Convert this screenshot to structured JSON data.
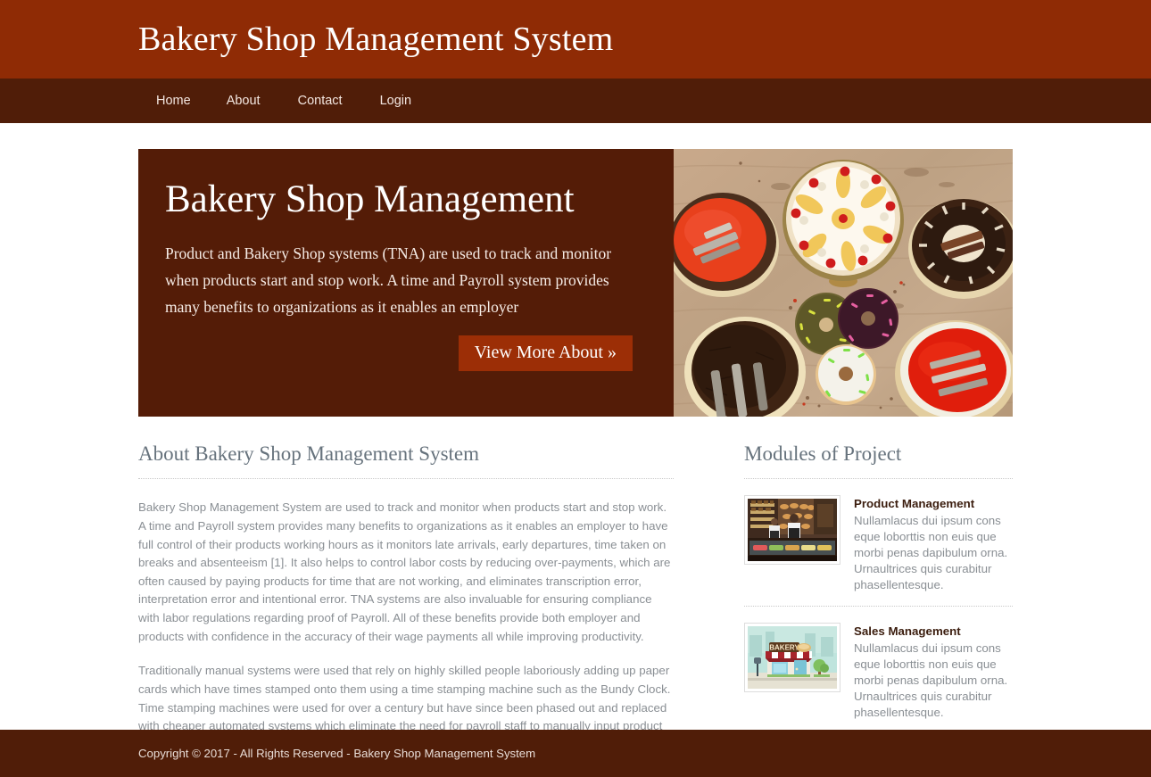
{
  "header": {
    "title": "Bakery Shop Management System",
    "bg_color": "#8f2b05"
  },
  "nav": {
    "bg_color": "#501d08",
    "items": [
      {
        "label": "Home"
      },
      {
        "label": "About"
      },
      {
        "label": "Contact"
      },
      {
        "label": "Login"
      }
    ]
  },
  "hero": {
    "bg_color": "#541c07",
    "title": "Bakery Shop Management",
    "description": "Product and Bakery Shop systems (TNA) are used to track and monitor when products start and stop work. A time and Payroll system provides many benefits to organizations as it enables an employer",
    "button_label": "View More About »",
    "button_color": "#9c2e06",
    "image_name": "assorted-cakes-and-donuts-photo"
  },
  "about": {
    "heading": "About Bakery Shop Management System",
    "paragraphs": [
      "Bakery Shop Management System are used to track and monitor when products start and stop work. A time and Payroll system provides many benefits to organizations as it enables an employer to have full control of their products working hours as it monitors late arrivals, early departures, time taken on breaks and absenteeism [1]. It also helps to control labor costs by reducing over-payments, which are often caused by paying products for time that are not working, and eliminates transcription error, interpretation error and intentional error. TNA systems are also invaluable for ensuring compliance with labor regulations regarding proof of Payroll. All of these benefits provide both employer and products with confidence in the accuracy of their wage payments all while improving productivity.",
      "Traditionally manual systems were used that rely on highly skilled people laboriously adding up paper cards which have times stamped onto them using a time stamping machine such as the Bundy Clock. Time stamping machines were used for over a century but have since been phased out and replaced with cheaper automated systems which eliminate the need for payroll staff to manually input product hours."
    ]
  },
  "modules": {
    "heading": "Modules of Project",
    "items": [
      {
        "title": "Product Management",
        "description": "Nullamlacus dui ipsum cons eque loborttis non euis que morbi penas dapibulum orna. Urnaultrices quis curabitur phasellentesque.",
        "image_name": "bakery-shop-interior-photo"
      },
      {
        "title": "Sales Management",
        "description": "Nullamlacus dui ipsum cons eque loborttis non euis que morbi penas dapibulum orna. Urnaultrices quis curabitur phasellentesque.",
        "image_name": "bakery-storefront-illustration"
      }
    ]
  },
  "footer": {
    "text": "Copyright © 2017 - All Rights Reserved - Bakery Shop Management System",
    "bg_color": "#501d08"
  }
}
